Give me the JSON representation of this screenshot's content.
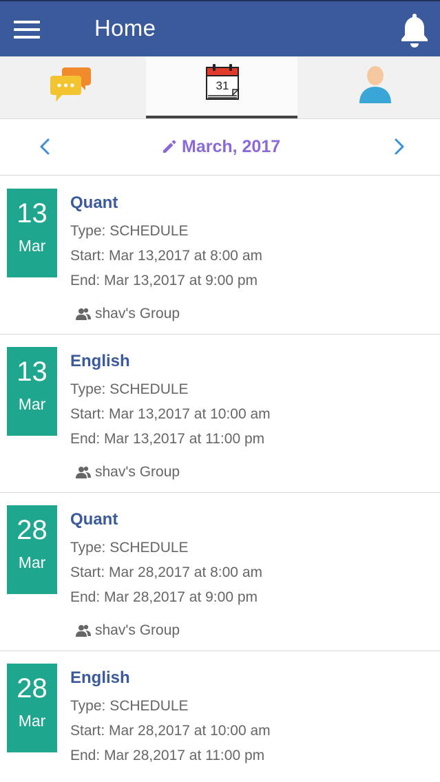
{
  "app": {
    "title": "Home"
  },
  "tabs": [
    {
      "name": "messages",
      "icon": "chat-bubbles-icon"
    },
    {
      "name": "calendar",
      "icon": "calendar-icon",
      "day": "31",
      "active": true
    },
    {
      "name": "profile",
      "icon": "user-icon"
    }
  ],
  "month_nav": {
    "label": "March, 2017"
  },
  "events": [
    {
      "day": "13",
      "month": "Mar",
      "title": "Quant",
      "type": "Type: SCHEDULE",
      "start": "Start: Mar 13,2017 at 8:00 am",
      "end": "End: Mar 13,2017 at 9:00 pm",
      "group": "shav's Group"
    },
    {
      "day": "13",
      "month": "Mar",
      "title": "English",
      "type": "Type: SCHEDULE",
      "start": "Start: Mar 13,2017 at 10:00 am",
      "end": "End: Mar 13,2017 at 11:00 pm",
      "group": "shav's Group"
    },
    {
      "day": "28",
      "month": "Mar",
      "title": "Quant",
      "type": "Type: SCHEDULE",
      "start": "Start: Mar 28,2017 at 8:00 am",
      "end": "End: Mar 28,2017 at 9:00 pm",
      "group": "shav's Group"
    },
    {
      "day": "28",
      "month": "Mar",
      "title": "English",
      "type": "Type: SCHEDULE",
      "start": "Start: Mar 28,2017 at 10:00 am",
      "end": "End: Mar 28,2017 at 11:00 pm",
      "group": ""
    }
  ],
  "colors": {
    "appbar": "#3a5a9b",
    "badge": "#1fa68e",
    "month_label": "#8a6ad6",
    "title": "#3a5a9b"
  }
}
